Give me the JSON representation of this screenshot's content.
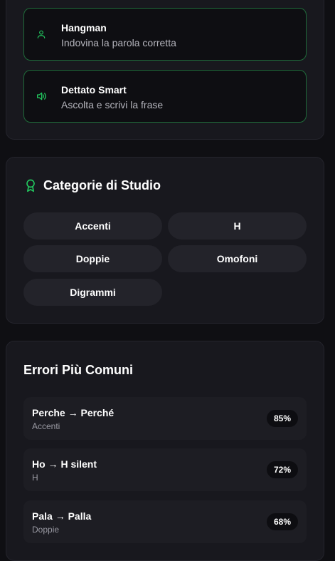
{
  "games": [
    {
      "title": "Hangman",
      "description": "Indovina la parola corretta",
      "icon": "user-icon"
    },
    {
      "title": "Dettato Smart",
      "description": "Ascolta e scrivi la frase",
      "icon": "speaker-icon"
    }
  ],
  "categories": {
    "title": "Categorie di Studio",
    "icon": "award-icon",
    "items": [
      "Accenti",
      "H",
      "Doppie",
      "Omofoni",
      "Digrammi"
    ]
  },
  "errors": {
    "title": "Errori Più Comuni",
    "items": [
      {
        "title": "Perche → Perché",
        "category": "Accenti",
        "percent": "85%"
      },
      {
        "title": "Ho → H silent",
        "category": "H",
        "percent": "72%"
      },
      {
        "title": "Pala → Palla",
        "category": "Doppie",
        "percent": "68%"
      }
    ]
  },
  "colors": {
    "accent": "#22c55e",
    "card_bg": "#18181e",
    "page_bg": "#0f0f13"
  }
}
